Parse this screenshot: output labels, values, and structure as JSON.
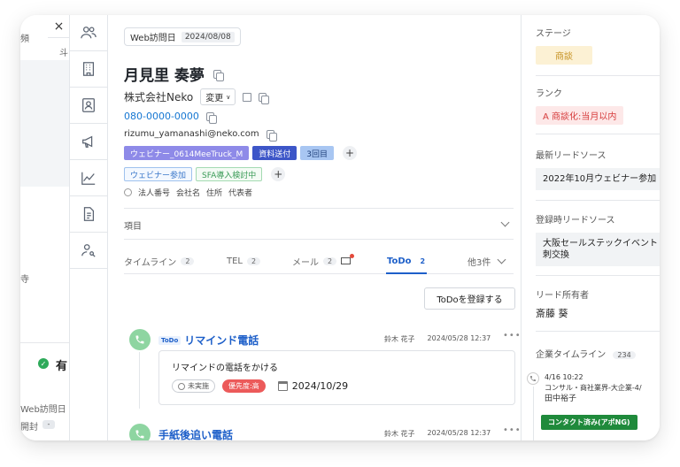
{
  "left_pane": {
    "close_glyph": "×",
    "frag_top_left": "頻",
    "frag_top_right": "斗",
    "frag_mid": "寺",
    "frag_ok_label": "有",
    "frag_visit": "Web訪問日",
    "frag_open": "開封",
    "frag_dash": "-"
  },
  "rail": {
    "icons": [
      "people-icon",
      "building-icon",
      "contact-card-icon",
      "megaphone-icon",
      "chart-icon",
      "document-icon",
      "person-key-icon"
    ]
  },
  "header": {
    "visit_label": "Web訪問日",
    "visit_date": "2024/08/08",
    "name": "月見里 奏夢",
    "company": "株式会社Neko",
    "change_label": "変更",
    "phone": "080-0000-0000",
    "email": "rizumu_yamanashi@neko.com"
  },
  "tags_primary": [
    "ウェビナー_0614MeeTruck_M",
    "資料送付",
    "3回目"
  ],
  "tags_secondary": [
    "ウェビナー参加",
    "SFA導入検討中"
  ],
  "search_links": [
    "法人番号",
    "会社名",
    "住所",
    "代表者"
  ],
  "section_label": "項目",
  "tabs": [
    {
      "label": "タイムライン",
      "count": "2"
    },
    {
      "label": "TEL",
      "count": "2"
    },
    {
      "label": "メール",
      "count": "2"
    },
    {
      "label": "ToDo",
      "count": "2"
    },
    {
      "label": "他3件"
    }
  ],
  "register_todo_label": "ToDoを登録する",
  "todos": [
    {
      "tag": "ToDo",
      "title": "リマインド電話",
      "assignee": "鈴木 花子",
      "datetime": "2024/05/28 12:37",
      "description": "リマインドの電話をかける",
      "status": "未実施",
      "priority": "優先度:高",
      "due": "2024/10/29"
    },
    {
      "title": "手紙後追い電話",
      "assignee": "鈴木 花子",
      "datetime": "2024/05/28 12:37"
    }
  ],
  "right_panel": {
    "stage_label": "ステージ",
    "stage_value": "商談",
    "rank_label": "ランク",
    "rank_value": "A 商談化:当月以内",
    "latest_source_label": "最新リードソース",
    "latest_source_value": "2022年10月ウェビナー参加",
    "reg_source_label": "登録時リードソース",
    "reg_source_line1": "大阪セールステックイベント",
    "reg_source_line2": "刺交換",
    "owner_label": "リード所有者",
    "owner_value": "斎藤 葵",
    "company_timeline_label": "企業タイムライン",
    "company_timeline_count": "234",
    "timeline_date": "4/16 10:22",
    "timeline_line1": "コンサル・商社業界-大企業-4/",
    "timeline_line2": "田中裕子",
    "contact_badge": "コンタクト済み(アポNG)"
  },
  "colors": {
    "accent": "#1d5fc9",
    "stage_bg": "#fcf1d4",
    "rank_bg": "#fde8e8",
    "green": "#1f8a3b"
  }
}
